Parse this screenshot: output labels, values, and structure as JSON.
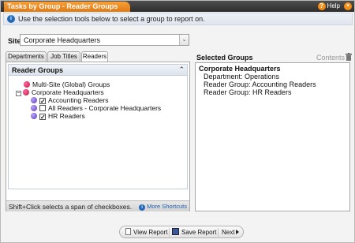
{
  "window": {
    "title": "Tasks by Group - Reader Groups",
    "help_label": "Help",
    "close_glyph": "×",
    "help_glyph": "?"
  },
  "info": {
    "text": "Use the selection tools below to select a group to report on.",
    "icon_glyph": "i"
  },
  "site": {
    "label": "Site",
    "value": "Corporate Headquarters",
    "arrow_glyph": "⌄"
  },
  "tabs": [
    {
      "label": "Departments",
      "active": false
    },
    {
      "label": "Job Titles",
      "active": false
    },
    {
      "label": "Readers",
      "active": true
    }
  ],
  "tree": {
    "header": "Reader Groups",
    "collapse_glyph": "⌃",
    "nodes": [
      {
        "label": "Multi-Site (Global) Groups",
        "dot": "red",
        "expander": "",
        "checked": null
      },
      {
        "label": "Corporate Headquarters",
        "dot": "red",
        "expander": "−",
        "checked": null
      },
      {
        "label": "Accounting Readers",
        "dot": "purple",
        "expander": "",
        "checked": true
      },
      {
        "label": "All Readers - Corporate Headquarters",
        "dot": "purple",
        "expander": "",
        "checked": false
      },
      {
        "label": "HR Readers",
        "dot": "purple",
        "expander": "",
        "checked": true
      }
    ]
  },
  "status": {
    "text": "Shift+Click selects a span of checkboxes.",
    "more_shortcuts": "More Shortcuts"
  },
  "selected": {
    "title": "Selected Groups",
    "contents_label": "Contents",
    "items": [
      {
        "text": "Corporate Headquarters",
        "bold": true
      },
      {
        "text": "Department: Operations",
        "bold": false
      },
      {
        "text": "Reader Group: Accounting Readers",
        "bold": false
      },
      {
        "text": "Reader Group: HR Readers",
        "bold": false
      }
    ]
  },
  "footer": {
    "view_report": "View Report",
    "save_report": "Save Report",
    "next": "Next"
  },
  "colors": {
    "accent_orange": "#e27a12",
    "link_blue": "#1f5fae"
  }
}
